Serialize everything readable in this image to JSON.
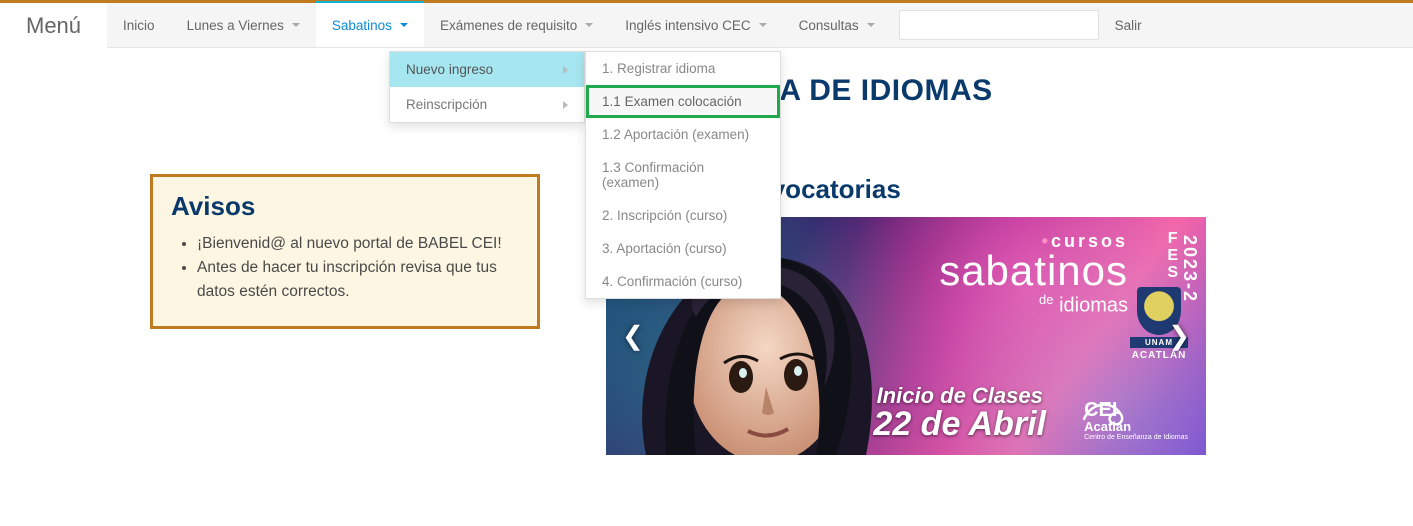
{
  "brand": "Menú",
  "nav": {
    "inicio": "Inicio",
    "lunes": "Lunes a Viernes",
    "sabatinos": "Sabatinos",
    "examenes": "Exámenes de requisito",
    "ingles": "Inglés intensivo CEC",
    "consultas": "Consultas",
    "salir": "Salir"
  },
  "dropdown": {
    "nuevo_ingreso": "Nuevo ingreso",
    "reinscripcion": "Reinscripción"
  },
  "submenu": {
    "s1": "1. Registrar idioma",
    "s1_1": "1.1 Examen colocación",
    "s1_2": "1.2 Aportación (examen)",
    "s1_3": "1.3 Confirmación (examen)",
    "s2": "2. Inscripción (curso)",
    "s3": "3. Aportación (curso)",
    "s4": "4. Confirmación (curso)"
  },
  "page_title": "CENTRO DE ENSEÑANZA DE IDIOMAS",
  "avisos": {
    "title": "Avisos",
    "item1": "¡Bienvenid@ al nuevo portal de BABEL CEI!",
    "item2": "Antes de hacer tu inscripción revisa que tus datos estén correctos."
  },
  "convocatorias": {
    "title": "Nuestras convocatorias"
  },
  "banner": {
    "cursos": "cursos",
    "sabatinos": "sabatinos",
    "de": "de",
    "idiomas": "idiomas",
    "year": "2023-2",
    "inicio": "Inicio de Clases",
    "fecha": "22 de Abril",
    "cei": "CEI",
    "acatlan": "Acatlán",
    "cei_sub": "Centro de Enseñanza de Idiomas",
    "fes_f": "F",
    "fes_e": "E",
    "fes_s": "S",
    "unam": "UNAM",
    "acatlan_badge": "ACATLÁN"
  }
}
